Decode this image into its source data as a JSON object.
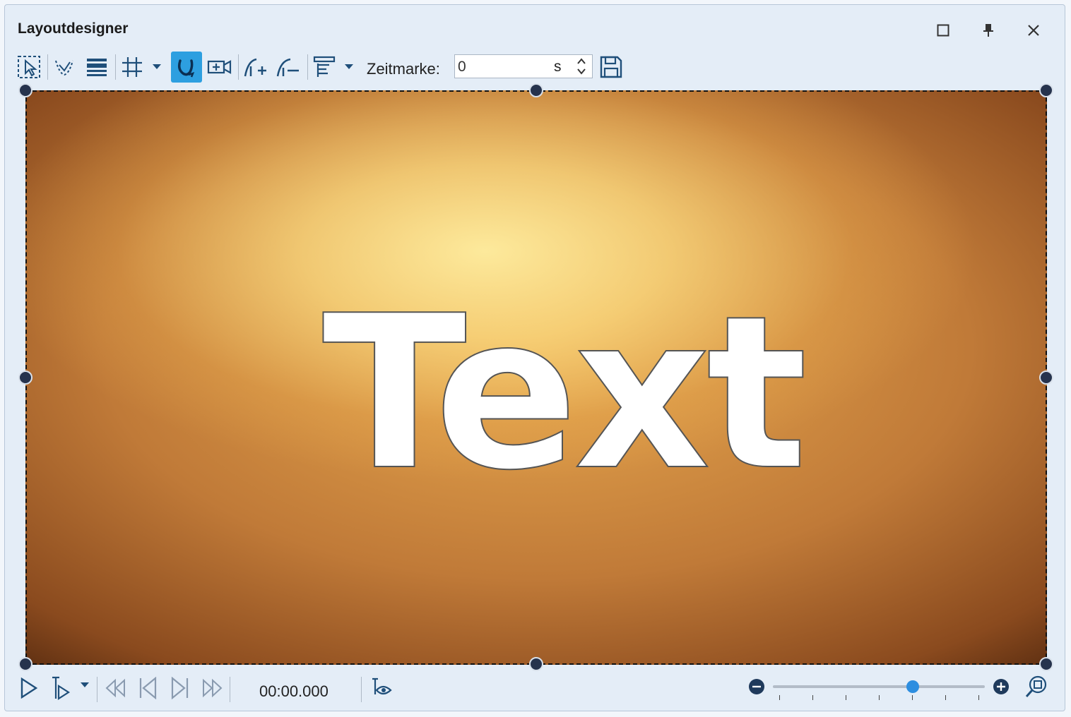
{
  "window": {
    "title": "Layoutdesigner"
  },
  "toolbar": {
    "zeitmarke_label": "Zeitmarke:",
    "zeitmarke_value": "0",
    "zeitmarke_unit": "s"
  },
  "canvas": {
    "text": "Text"
  },
  "playback": {
    "time": "00:00.000",
    "zoom_fraction": 0.66
  },
  "colors": {
    "accent": "#2d9fe0",
    "icon": "#1f4f7a",
    "handle": "#26334d"
  }
}
